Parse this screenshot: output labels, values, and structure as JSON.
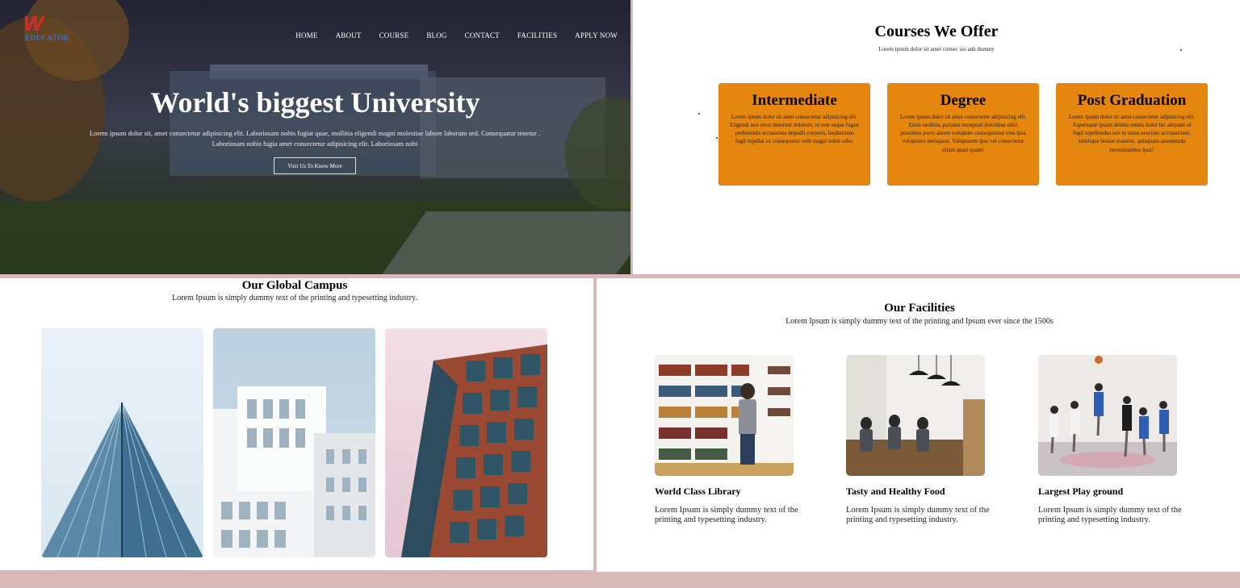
{
  "hero": {
    "logo_mark": "W",
    "logo_text": "EDUCATOR",
    "nav": [
      "HOME",
      "ABOUT",
      "COURSE",
      "BLOG",
      "CONTACT",
      "FACILITIES",
      "APPLY NOW"
    ],
    "title": "World's biggest University",
    "description": "Lorem ipsum dolor sit, amet consectetur adipisicing elit. Laboriosam nobis fugiat quae, mollitia eligendi magni molestiae labore laborum sed. Consequatur tenetur . Laboriosam nobis fugia amet consectetur adipisicing elit. Laboriosam nobi",
    "button": "Visit Us To Know More"
  },
  "courses": {
    "title": "Courses We Offer",
    "subtitle": "Lorem ipsum dolor sit amet consec sio anh dummy",
    "cards": [
      {
        "title": "Intermediate",
        "text": "Lorem ipsum dolor sit amet consectetur adipisicing elit. Eligendi non error deserunt dolorum, ut rem eaque fugiat perferendis accusamus impedit corporis, laudantium fugit repellat ex consequatur velit magni nobis odio."
      },
      {
        "title": "Degree",
        "text": "Lorem ipsum dolor sit amet consectetur adipisicing elit. Enim mollitia, pariatur excepturi doloribus nihil possimus porro autem voluptate consequuntur eius ipsa voluptates nemquam. Voluptatem ipsa vel consectetur ullam quasi quam!"
      },
      {
        "title": "Post Graduation",
        "text": "Lorem ipsum dolor sit amet consectetur adipisicing elit. Aspernatur ipsam debitis omnis dolor hic aliquam ut fugit repellendus iste in natus nesciunt accusantium, similique beatae maiores, quisquam assumenda necessitatibus ipsa?"
      }
    ]
  },
  "campus": {
    "title": "Our Global Campus",
    "subtitle": "Lorem Ipsum is simply dummy text of the printing and typesetting industry."
  },
  "facilities": {
    "title": "Our Facilities",
    "subtitle": "Lorem Ipsum is simply dummy text of the printing and Ipsum ever since the 1500s",
    "items": [
      {
        "title": "World Class Library",
        "text": "Lorem Ipsum is simply dummy text of the printing and typesetting industry."
      },
      {
        "title": "Tasty and Healthy Food",
        "text": "Lorem Ipsum is simply dummy text of the printing and typesetting industry."
      },
      {
        "title": "Largest Play ground",
        "text": "Lorem Ipsum is simply dummy text of the printing and typesetting industry."
      }
    ]
  },
  "colors": {
    "card_orange": "#e5870f",
    "logo_red": "#d62b2b",
    "logo_blue": "#3a6fd8",
    "frame": "#d8b8b8"
  }
}
